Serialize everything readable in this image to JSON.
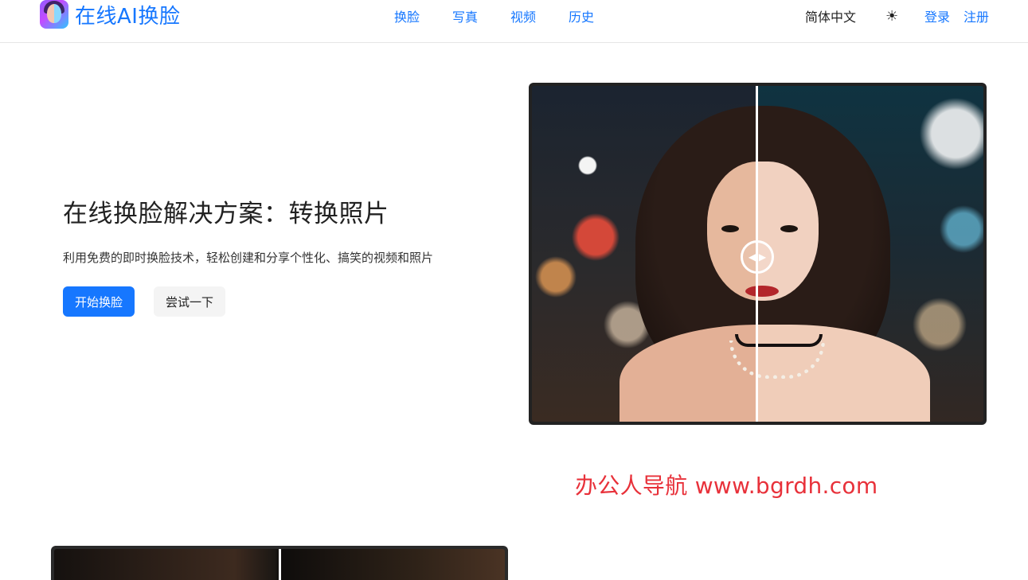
{
  "header": {
    "brand_title": "在线AI换脸",
    "nav": [
      "换脸",
      "写真",
      "视频",
      "历史"
    ],
    "language": "简体中文",
    "theme_icon": "☀",
    "login": "登录",
    "register": "注册"
  },
  "hero": {
    "title": "在线换脸解决方案：转换照片",
    "subtitle": "利用免费的即时换脸技术，轻松创建和分享个性化、搞笑的视频和照片",
    "primary_button": "开始换脸",
    "secondary_button": "尝试一下"
  },
  "compare": {
    "handle_icon": "◀ ▶"
  },
  "watermark": "办公人导航 www.bgrdh.com",
  "colors": {
    "accent": "#1677ff",
    "watermark": "#e8313a"
  }
}
